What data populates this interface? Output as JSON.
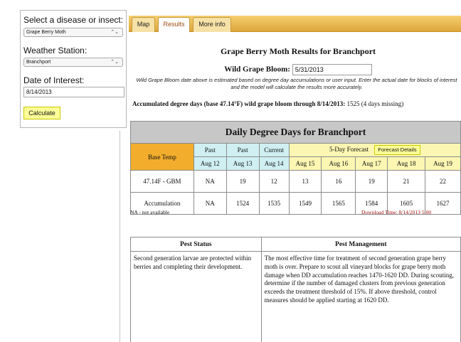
{
  "form": {
    "disease_label": "Select a disease or insect:",
    "disease_value": "Grape Berry Moth",
    "station_label": "Weather Station:",
    "station_value": "Branchport",
    "date_label": "Date of Interest:",
    "date_value": "8/14/2013",
    "calculate_label": "Calculate"
  },
  "tabs": [
    "Map",
    "Results",
    "More info"
  ],
  "active_tab": "Results",
  "results": {
    "title": "Grape Berry Moth Results for Branchport",
    "bloom_label": "Wild Grape Bloom:",
    "bloom_value": "5/31/2013",
    "bloom_note": "Wild Grape Bloom date above is estimated based on degree day accumulations or user input. Enter the actual date for blocks of interest and the model will calculate the results more accurately.",
    "accum_label": "Accumulated degree days (base 47.14°F) wild grape bloom through 8/14/2013:",
    "accum_value": "1525 (4 days missing)"
  },
  "dd_table": {
    "title": "Daily Degree Days for Branchport",
    "base_temp_header": "Base Temp",
    "past_header": "Past",
    "current_header": "Current",
    "forecast_header": "5-Day Forecast",
    "forecast_button": "Forecast Details",
    "dates": [
      "Aug 12",
      "Aug 13",
      "Aug 14",
      "Aug 15",
      "Aug 16",
      "Aug 17",
      "Aug 18",
      "Aug 19"
    ],
    "rows": [
      {
        "label": "47.14F - GBM",
        "values": [
          "NA",
          "19",
          "12",
          "13",
          "16",
          "19",
          "21",
          "22"
        ]
      },
      {
        "label": "Accumulation",
        "values": [
          "NA",
          "1524",
          "1535",
          "1549",
          "1565",
          "1584",
          "1605",
          "1627"
        ]
      }
    ],
    "na_note": "NA - not available",
    "download_time": "Download Time: 8/14/2013 5:00"
  },
  "pest_table": {
    "status_header": "Pest Status",
    "management_header": "Pest Management",
    "status_text": "Second generation larvae are protected within berries and completing their development.",
    "management_text": "The most effective time for treatment of second generation grape berry moth is over. Prepare to scout all vineyard blocks for grape berry moth damage when DD accumulation reaches 1470-1620 DD. During scouting, determine if the number of damaged clusters from previous generation exceeds the treatment threshold of 15%. If above threshold, control measures should be applied starting at 1620 DD."
  },
  "colors": {
    "tab_bar": "#dfa63c",
    "base_temp_cell": "#f2ad2c",
    "past_cells": "#cfeff2",
    "forecast_cells": "#fbf6b2",
    "table_title_bg": "#c7c7c7",
    "download_text": "#a01818",
    "calculate_button": "#ffff99"
  }
}
